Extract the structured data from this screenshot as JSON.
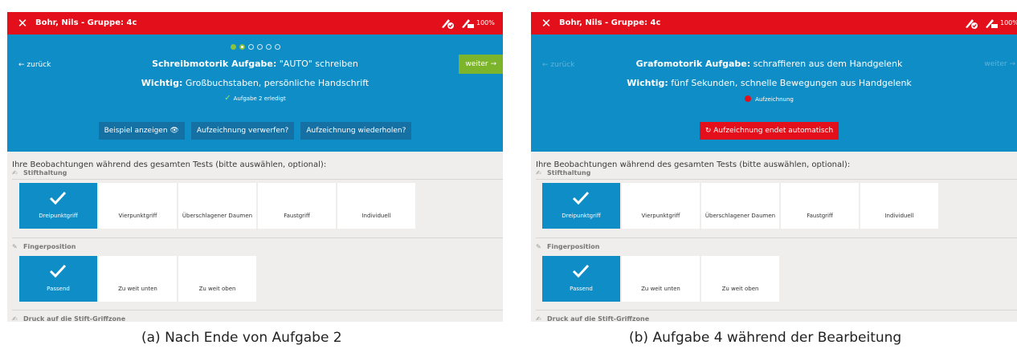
{
  "colors": {
    "header_red": "#e3101b",
    "task_blue": "#0f8dc6",
    "button_dark_blue": "#1571a4",
    "next_green": "#7cb52c",
    "background_grey": "#efeeec"
  },
  "panel_a": {
    "titlebar": {
      "close_icon": "close-icon",
      "name": "Bohr, Nils - Gruppe: 4c",
      "status_icons": [
        "pen-check-icon",
        "pen-battery-icon"
      ],
      "battery": "100%"
    },
    "progress": {
      "total": 6,
      "completed": 1,
      "current": 2
    },
    "nav": {
      "back": "← zurück",
      "next": "weiter →"
    },
    "task_label": "Schreibmotorik Aufgabe:",
    "task_text": " \"AUTO\" schreiben",
    "important_label": "Wichtig:",
    "important_text": " Großbuchstaben, persönliche Handschrift",
    "status_text": "Aufgabe 2 erledigt",
    "buttons": {
      "example": "Beispiel anzeigen",
      "discard": "Aufzeichnung verwerfen?",
      "repeat": "Aufzeichnung wiederholen?"
    },
    "observations_intro": "Ihre Beobachtungen während des gesamten Tests (bitte auswählen, optional):",
    "sections": {
      "pen_grip": {
        "title": "Stifthaltung",
        "options": [
          "Dreipunktgriff",
          "Vierpunktgriff",
          "Überschlagener Daumen",
          "Faustgriff",
          "Individuell"
        ],
        "selected": "Dreipunktgriff"
      },
      "finger_position": {
        "title": "Fingerposition",
        "options": [
          "Passend",
          "Zu weit unten",
          "Zu weit oben"
        ],
        "selected": "Passend"
      },
      "pressure": {
        "title": "Druck auf die Stift-Griffzone"
      }
    }
  },
  "panel_b": {
    "titlebar": {
      "close_icon": "close-icon",
      "name": "Bohr, Nils - Gruppe: 4c",
      "status_icons": [
        "pen-check-icon",
        "pen-battery-icon"
      ],
      "battery": "100%"
    },
    "nav": {
      "back": "← zurück",
      "next": "weiter →"
    },
    "task_label": "Grafomotorik Aufgabe:",
    "task_text": " schraffieren aus dem Handgelenk",
    "important_label": "Wichtig:",
    "important_text": " fünf Sekunden, schnelle Bewegungen aus Handgelenk",
    "status_text": "Aufzeichnung",
    "buttons": {
      "auto_end": "Aufzeichnung endet automatisch"
    },
    "observations_intro": "Ihre Beobachtungen während des gesamten Tests (bitte auswählen, optional):",
    "sections": {
      "pen_grip": {
        "title": "Stifthaltung",
        "options": [
          "Dreipunktgriff",
          "Vierpunktgriff",
          "Überschlagener Daumen",
          "Faustgriff",
          "Individuell"
        ],
        "selected": "Dreipunktgriff"
      },
      "finger_position": {
        "title": "Fingerposition",
        "options": [
          "Passend",
          "Zu weit unten",
          "Zu weit oben"
        ],
        "selected": "Passend"
      },
      "pressure": {
        "title": "Druck auf die Stift-Griffzone"
      }
    }
  },
  "captions": {
    "a": "(a) Nach Ende von Aufgabe 2",
    "b": "(b) Aufgabe 4 während der Bearbeitung"
  }
}
